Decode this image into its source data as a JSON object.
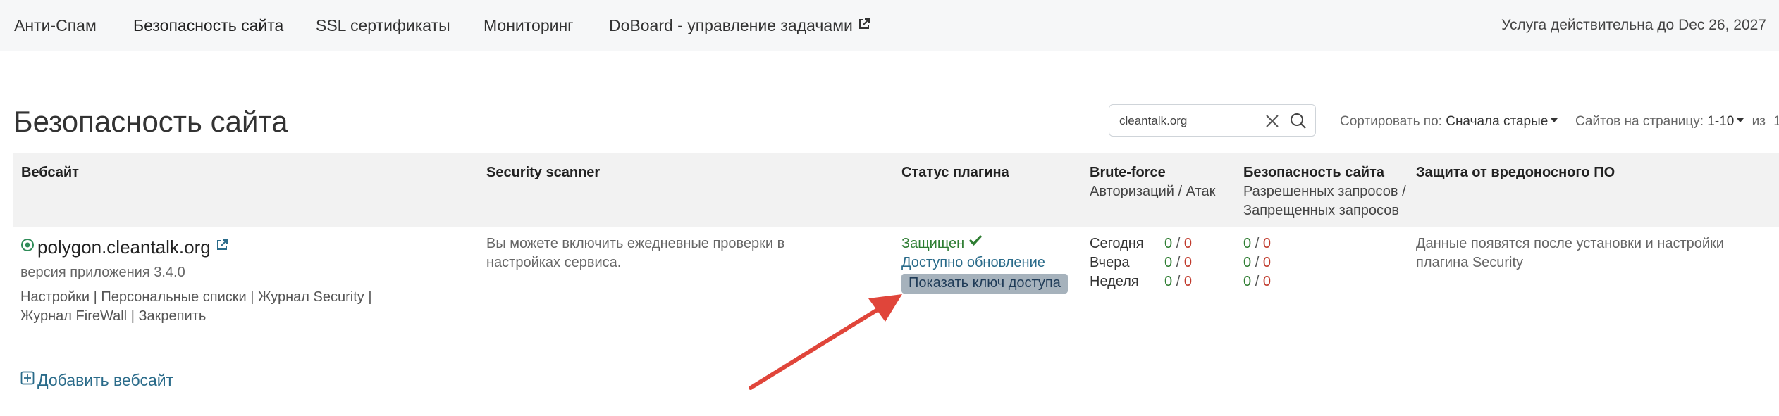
{
  "nav": {
    "items": [
      {
        "label": "Анти-Спам"
      },
      {
        "label": "Безопасность сайта"
      },
      {
        "label": "SSL сертификаты"
      },
      {
        "label": "Мониторинг"
      },
      {
        "label": "DoBoard - управление задачами"
      }
    ],
    "service_until": "Услуга действительна до Dec 26, 2027"
  },
  "page": {
    "title": "Безопасность сайта"
  },
  "search": {
    "value": "cleantalk.org"
  },
  "sort": {
    "label": "Сортировать по:",
    "value": "Сначала старые"
  },
  "perpage": {
    "label": "Сайтов на страницу:",
    "value": "1-10",
    "of_label": "из",
    "total": "1"
  },
  "table": {
    "headers": {
      "website": "Вебсайт",
      "scanner": "Security scanner",
      "plugin_status": "Статус плагина",
      "bruteforce": "Brute-force",
      "bruteforce_sub": "Авторизаций / Атак",
      "security": "Безопасность сайта",
      "security_sub_1": "Разрешенных запросов /",
      "security_sub_2": "Запрещенных запросов",
      "malware": "Защита от вредоносного ПО"
    },
    "row": {
      "site": "polygon.cleantalk.org",
      "version": "версия приложения 3.4.0",
      "links": [
        "Настройки",
        "Персональные списки",
        "Журнал Security",
        "Журнал FireWall",
        "Закрепить"
      ],
      "scanner_text_1": "Вы можете включить ежедневные проверки в",
      "scanner_text_2": "настройках сервиса.",
      "status_protected": "Защищен",
      "status_update": "Доступно обновление",
      "key_button": "Показать ключ доступа",
      "periods": [
        "Сегодня",
        "Вчера",
        "Неделя"
      ],
      "bruteforce": [
        {
          "a": "0",
          "b": "0"
        },
        {
          "a": "0",
          "b": "0"
        },
        {
          "a": "0",
          "b": "0"
        }
      ],
      "security": [
        {
          "a": "0",
          "b": "0"
        },
        {
          "a": "0",
          "b": "0"
        },
        {
          "a": "0",
          "b": "0"
        }
      ],
      "malware_text_1": "Данные появятся после установки и настройки",
      "malware_text_2": "плагина Security"
    }
  },
  "add_site": "Добавить вебсайт",
  "colors": {
    "accent_blue": "#2a6b8a",
    "green": "#2e7d32",
    "red": "#c0392b",
    "arrow": "#e0453a",
    "key_button_bg": "#a6b2bc"
  }
}
